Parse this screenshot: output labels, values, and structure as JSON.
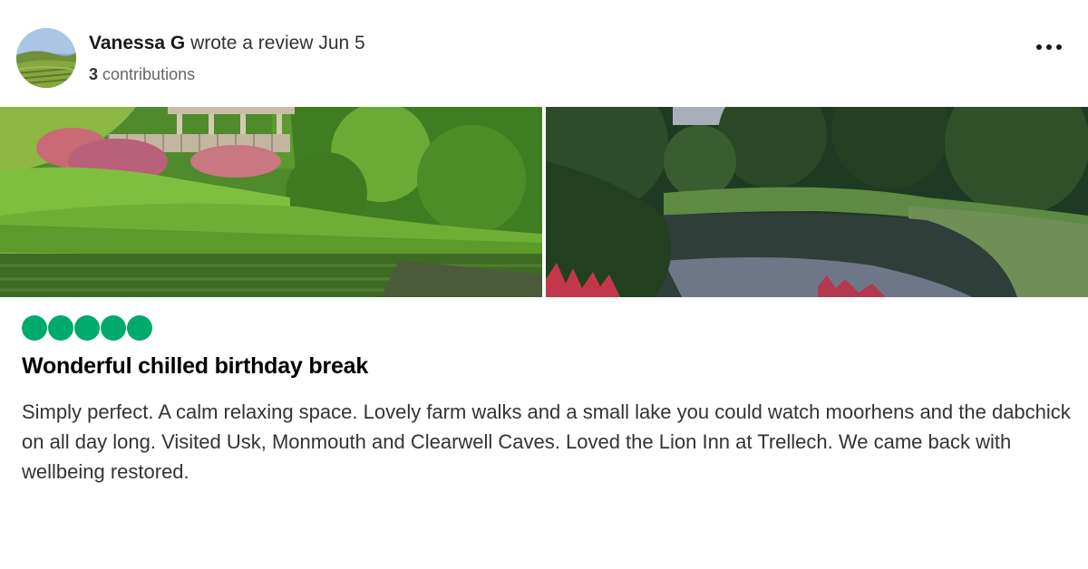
{
  "reviewer": {
    "name": "Vanessa G",
    "action_text": "wrote a review",
    "date": "Jun 5",
    "contribution_count": "3",
    "contribution_label": "contributions"
  },
  "menu": {
    "icon": "more-horizontal-icon"
  },
  "photos": [
    {
      "name": "garden-gazebo-pond-photo"
    },
    {
      "name": "woodland-pond-photo"
    }
  ],
  "review": {
    "rating": 5,
    "rating_max": 5,
    "rating_color": "#00aa6c",
    "title": "Wonderful chilled birthday break",
    "body": "Simply perfect. A calm relaxing space. Lovely farm walks and a small lake you could watch moorhens and the dabchick on all day long. Visited Usk, Monmouth and Clearwell Caves. Loved the Lion Inn at Trellech. We came back with wellbeing restored."
  }
}
